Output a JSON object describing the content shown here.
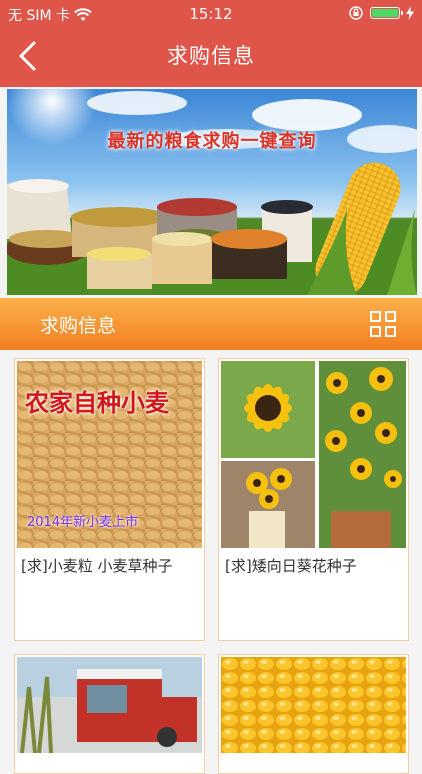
{
  "status_bar": {
    "carrier": "无 SIM 卡",
    "time": "15:12",
    "battery_level": 1.0
  },
  "nav": {
    "title": "求购信息",
    "back_icon": "chevron-left-icon"
  },
  "banner": {
    "headline": "最新的粮食求购一键查询"
  },
  "section": {
    "title": "求购信息",
    "view_toggle_icon": "grid-icon"
  },
  "products": [
    {
      "image_overlay_top": "农家自种小麦",
      "image_overlay_bottom": "2014年新小麦上市",
      "title": "[求]小麦粒 小麦草种子"
    },
    {
      "title": "[求]矮向日葵花种子"
    },
    {
      "title": ""
    },
    {
      "title": ""
    }
  ],
  "colors": {
    "nav_bg": "#e0554a",
    "section_bg": "#f6922e",
    "card_border": "#f1cfa0"
  }
}
